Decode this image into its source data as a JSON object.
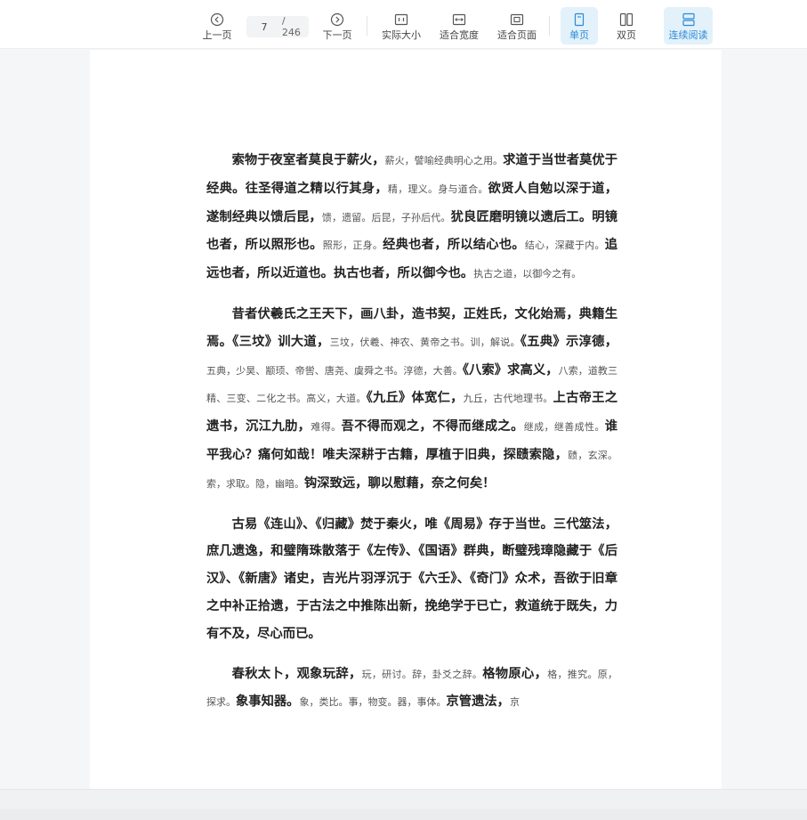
{
  "toolbar": {
    "prev_label": "上一页",
    "next_label": "下一页",
    "page_current": "7",
    "page_total": "/ 246",
    "actual_size_label": "实际大小",
    "fit_width_label": "适合宽度",
    "fit_page_label": "适合页面",
    "single_page_label": "单页",
    "double_page_label": "双页",
    "continuous_label": "连续阅读",
    "accent_color": "#2b8ad6"
  },
  "document": {
    "paragraphs": [
      [
        {
          "t": "索物于夜室者莫良于薪火，",
          "s": "b"
        },
        {
          "t": "薪火，譬喻经典明心之用。",
          "s": "n"
        },
        {
          "t": "求道于当世者莫优于经典。往圣得道之精以行其身，",
          "s": "b"
        },
        {
          "t": "精，理义。身与道合。",
          "s": "n"
        },
        {
          "t": "欲贤人自勉以深于道，遂制经典以馈后昆，",
          "s": "b"
        },
        {
          "t": "馈，遗留。后昆，子孙后代。",
          "s": "n"
        },
        {
          "t": "犹良匠磨明镜以遗后工。明镜也者，所以照形也。",
          "s": "b"
        },
        {
          "t": "照形，正身。",
          "s": "n"
        },
        {
          "t": "经典也者，所以结心也。",
          "s": "b"
        },
        {
          "t": "结心，深藏于内。",
          "s": "n"
        },
        {
          "t": "追远也者，所以近道也。执古也者，所以御今也。",
          "s": "b"
        },
        {
          "t": "执古之道，以御今之有。",
          "s": "n"
        }
      ],
      [
        {
          "t": "昔者伏羲氏之王天下，画八卦，造书契，正姓氏，文化始焉，典籍生焉。《三坟》训大道，",
          "s": "b"
        },
        {
          "t": "三坟，伏羲、神农、黄帝之书。训，解说。",
          "s": "n"
        },
        {
          "t": "《五典》示淳德，",
          "s": "b"
        },
        {
          "t": "五典，少昊、颛顼、帝喾、唐尧、虞舜之书。淳德，大善。",
          "s": "n"
        },
        {
          "t": "《八索》求高义，",
          "s": "b"
        },
        {
          "t": "八索，道教三精、三变、二化之书。高义，大道。",
          "s": "n"
        },
        {
          "t": "《九丘》体宽仁，",
          "s": "b"
        },
        {
          "t": "九丘，古代地理书。",
          "s": "n"
        },
        {
          "t": "上古帝王之遗书，沉江九肋，",
          "s": "b"
        },
        {
          "t": "难得。",
          "s": "n"
        },
        {
          "t": "吾不得而观之，不得而继成之。",
          "s": "b"
        },
        {
          "t": "继成，继善成性。",
          "s": "n"
        },
        {
          "t": "谁平我心？痛何如哉！唯夫深耕于古籍，厚植于旧典，探赜索隐，",
          "s": "b"
        },
        {
          "t": "赜，玄深。索，求取。隐，幽暗。",
          "s": "n"
        },
        {
          "t": "钩深致远，聊以慰藉，奈之何矣！",
          "s": "b"
        }
      ],
      [
        {
          "t": "古易《连山》、《归藏》焚于秦火，唯《周易》存于当世。三代筮法，庶几遗逸，和璧隋珠散落于《左传》、《国语》群典，断璧残璋隐藏于《后汉》、《新唐》诸史，吉光片羽浮沉于《六壬》、《奇门》众术，吾欲于旧章之中补正拾遗，于古法之中推陈出新，挽绝学于已亡，救道统于既失，力有不及，尽心而已。",
          "s": "b"
        }
      ],
      [
        {
          "t": "春秋太卜，观象玩辞，",
          "s": "b"
        },
        {
          "t": "玩，研讨。辞，卦爻之辞。",
          "s": "n"
        },
        {
          "t": "格物原心，",
          "s": "b"
        },
        {
          "t": "格，推究。原，探求。",
          "s": "n"
        },
        {
          "t": "象事知器。",
          "s": "b"
        },
        {
          "t": "象，类比。事，物变。器，事体。",
          "s": "n"
        },
        {
          "t": "京管遗法，",
          "s": "b"
        },
        {
          "t": "京",
          "s": "n"
        }
      ]
    ]
  }
}
